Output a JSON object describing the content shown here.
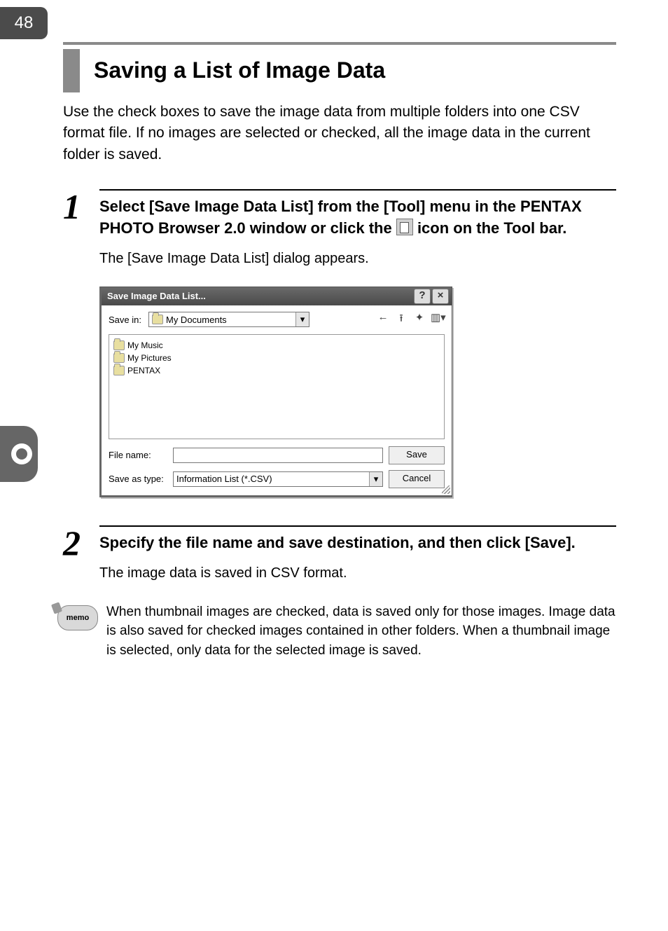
{
  "page_number": "48",
  "heading": "Saving a List of Image Data",
  "intro": "Use the check boxes to save the image data from multiple folders into one CSV format file. If no images are selected or checked, all the image data in the current folder is saved.",
  "step1": {
    "num": "1",
    "title_a": "Select [Save Image Data List] from the [Tool] menu in the PENTAX PHOTO Browser 2.0 window or click the ",
    "title_b": " icon on the Tool bar.",
    "desc": "The [Save Image Data List] dialog appears."
  },
  "dialog": {
    "title": "Save Image Data List...",
    "help_btn": "?",
    "close_btn": "×",
    "save_in_label": "Save in:",
    "save_in_value": "My Documents",
    "items": {
      "0": "My Music",
      "1": "My Pictures",
      "2": "PENTAX"
    },
    "file_name_label": "File name:",
    "file_name_value": "",
    "save_as_label": "Save as type:",
    "save_as_value": "Information List (*.CSV)",
    "save_btn": "Save",
    "cancel_btn": "Cancel"
  },
  "step2": {
    "num": "2",
    "title": "Specify the file name and save destination, and then click [Save].",
    "desc": "The image data is saved in CSV format."
  },
  "memo": {
    "label": "memo",
    "text": "When thumbnail images are checked, data is saved only for those images. Image data is also saved for checked images contained in other folders. When a thumbnail image is selected, only data for the selected image is saved."
  }
}
